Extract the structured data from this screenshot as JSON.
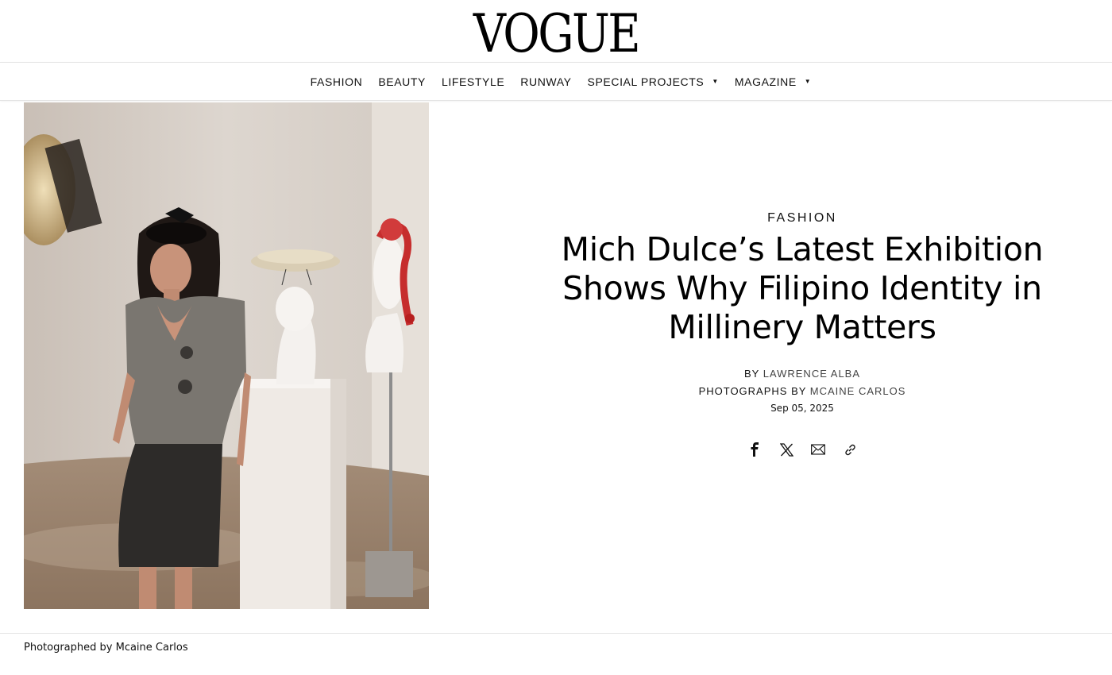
{
  "masthead": {
    "logo_text": "VOGUE"
  },
  "nav": {
    "items": [
      {
        "label": "FASHION"
      },
      {
        "label": "BEAUTY"
      },
      {
        "label": "LIFESTYLE"
      },
      {
        "label": "RUNWAY"
      },
      {
        "label": "SPECIAL PROJECTS",
        "dropdown": true
      },
      {
        "label": "MAGAZINE",
        "dropdown": true
      }
    ],
    "caret": "▼"
  },
  "article": {
    "category": "FASHION",
    "headline": "Mich Dulce’s Latest Exhibition Shows Why Filipino Identity in Millinery Matters",
    "byline_prefix": "BY",
    "author": "LAWRENCE ALBA",
    "photographer_prefix": "PHOTOGRAPHS BY",
    "photographer": "MCAINE CARLOS",
    "date": "Sep 05, 2025",
    "share": [
      "facebook-icon",
      "x-icon",
      "mail-icon",
      "link-icon"
    ]
  },
  "image": {
    "caption": "Photographed by Mcaine Carlos"
  },
  "colors": {
    "text": "#000000",
    "rule": "#e4e4e4",
    "link_gray": "#444444"
  }
}
